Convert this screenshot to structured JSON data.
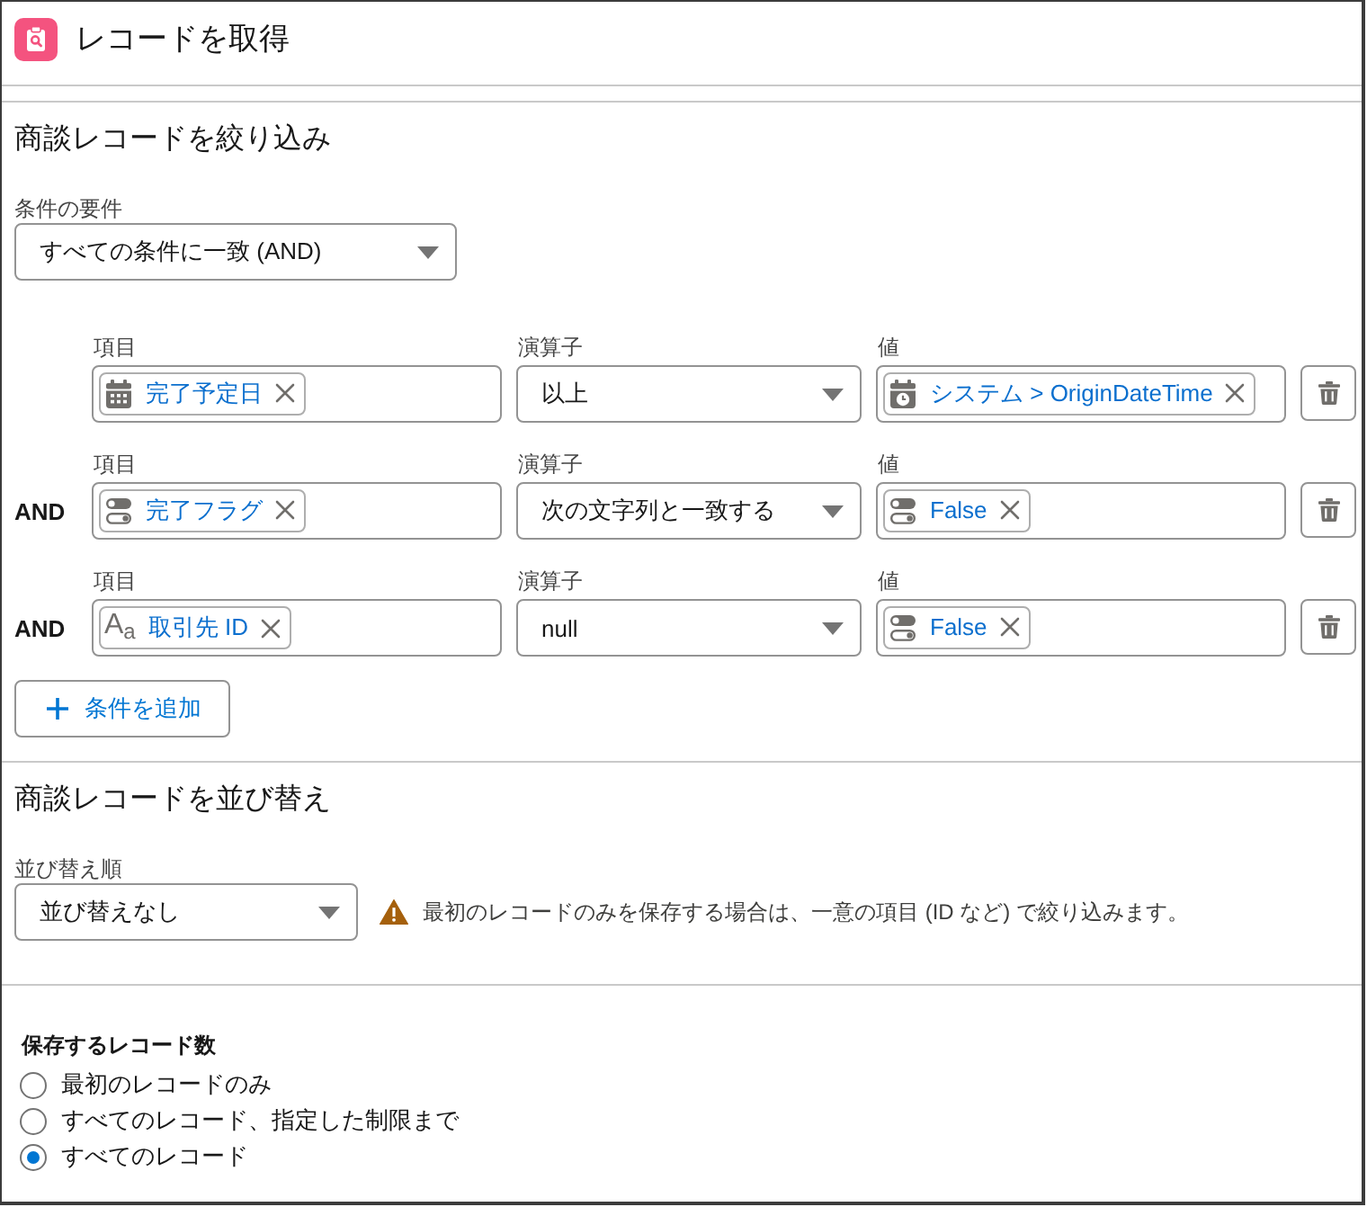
{
  "header": {
    "title": "レコードを取得"
  },
  "filter": {
    "heading": "商談レコードを絞り込み",
    "requirement": {
      "label": "条件の要件",
      "value": "すべての条件に一致 (AND)"
    },
    "conditions": [
      {
        "field_label": "項目",
        "field": {
          "kind": "date",
          "text": "完了予定日"
        },
        "operator_label": "演算子",
        "operator": "以上",
        "value_label": "値",
        "value": {
          "kind": "datetime",
          "text": "システム > OriginDateTime"
        }
      },
      {
        "connector": "AND",
        "field_label": "項目",
        "field": {
          "kind": "boolean",
          "text": "完了フラグ"
        },
        "operator_label": "演算子",
        "operator": "次の文字列と一致する",
        "value_label": "値",
        "value": {
          "kind": "boolean",
          "text": "False"
        }
      },
      {
        "connector": "AND",
        "field_label": "項目",
        "field": {
          "kind": "text",
          "glyph": "A$_{a}$",
          "text": "取引先 ID"
        },
        "operator_label": "演算子",
        "operator": "null",
        "value_label": "値",
        "value": {
          "kind": "boolean",
          "text": "False"
        }
      }
    ],
    "add_button": "条件を追加"
  },
  "sort": {
    "heading": "商談レコードを並び替え",
    "order": {
      "label": "並び替え順",
      "value": "並び替えなし"
    },
    "warning": "最初のレコードのみを保存する場合は、一意の項目 (ID など) で絞り込みます。"
  },
  "records_to_store": {
    "label": "保存するレコード数",
    "options": [
      {
        "label": "最初のレコードのみ",
        "selected": false
      },
      {
        "label": "すべてのレコード、指定した制限まで",
        "selected": false
      },
      {
        "label": "すべてのレコード",
        "selected": true
      }
    ]
  }
}
